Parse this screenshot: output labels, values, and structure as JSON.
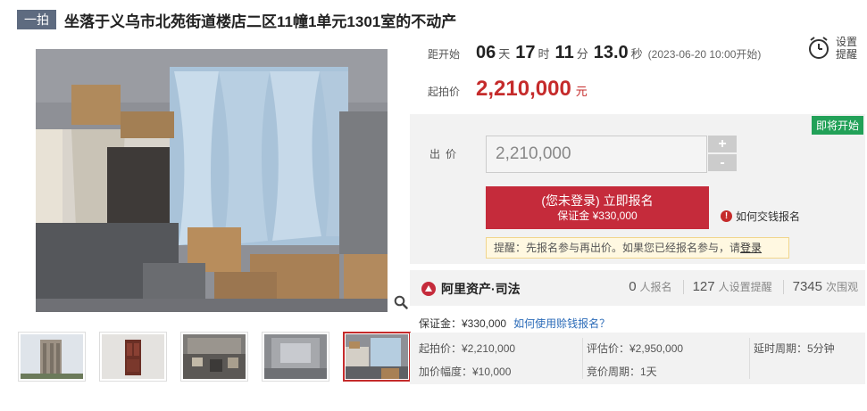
{
  "header": {
    "badge": "一拍",
    "title": "坐落于义乌市北苑街道楼店二区11幢1单元1301室的不动产"
  },
  "countdown": {
    "label": "距开始",
    "days": "06",
    "days_unit": "天",
    "hours": "17",
    "hours_unit": "时",
    "minutes": "11",
    "minutes_unit": "分",
    "seconds": "13.0",
    "seconds_unit": "秒",
    "start_note": "(2023-06-20 10:00开始)"
  },
  "reminder": {
    "label": "设置提醒",
    "icon": "alarm-clock-icon"
  },
  "start_price": {
    "label": "起拍价",
    "value": "2,210,000",
    "unit": "元"
  },
  "bid": {
    "tag": "即将开始",
    "label": "出价",
    "input_value": "2,210,000",
    "plus": "+",
    "minus": "-",
    "register_main": "(您未登录) 立即报名",
    "register_sub": "保证金 ¥330,000",
    "pay_info": "如何交钱报名",
    "notice_text": "提醒：先报名参与再出价。如果您已经报名参与，请",
    "notice_link": "登录"
  },
  "stats": {
    "brand": "阿里资产·司法",
    "signups": "0",
    "signups_label": "人报名",
    "reminders": "127",
    "reminders_label": "人设置提醒",
    "views": "7345",
    "views_label": "次围观"
  },
  "deposit": {
    "text": "保证金：¥330,000",
    "link": "如何使用赊钱报名？"
  },
  "info": {
    "start_price": "起拍价：¥2,210,000",
    "increment": "加价幅度：¥10,000",
    "appraisal": "评估价：¥2,950,000",
    "bid_period": "竞价周期：1天",
    "delay": "延时周期：5分钟"
  },
  "colors": {
    "accent": "#c52b3b",
    "badge": "#5e6b80",
    "tag_green": "#22a158",
    "link": "#2b6bb8"
  }
}
